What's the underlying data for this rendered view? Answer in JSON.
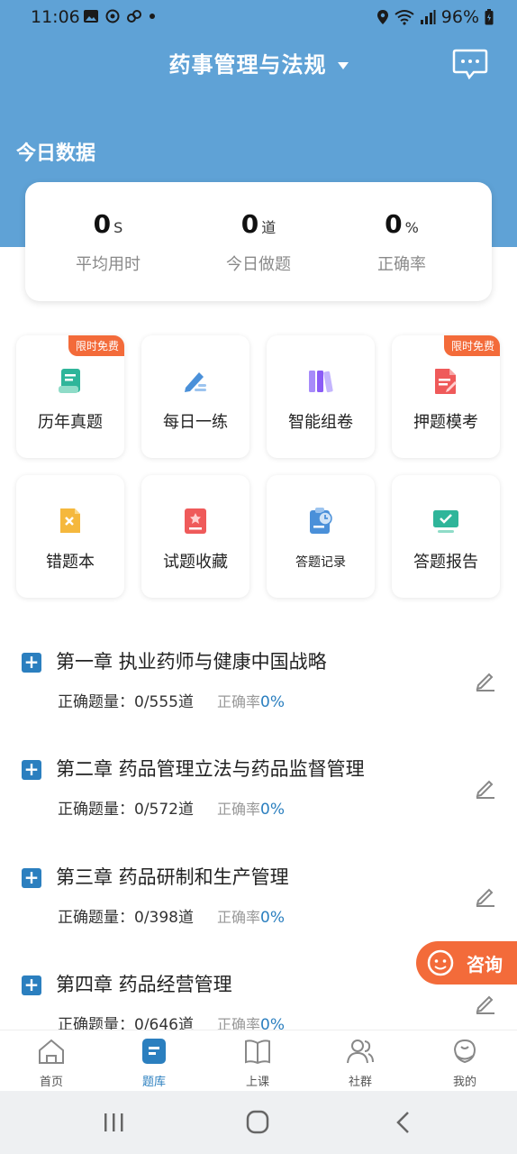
{
  "status_bar": {
    "time": "11:06",
    "battery": "96%"
  },
  "header": {
    "title": "药事管理与法规"
  },
  "today": {
    "section_title": "今日数据",
    "stats": [
      {
        "value": "0",
        "unit": "S",
        "label": "平均用时"
      },
      {
        "value": "0",
        "unit": "道",
        "label": "今日做题"
      },
      {
        "value": "0",
        "unit": "%",
        "label": "正确率"
      }
    ]
  },
  "tiles": [
    {
      "label": "历年真题",
      "badge": "限时免费",
      "icon": "book-icon",
      "color": "#2fb59a"
    },
    {
      "label": "每日一练",
      "badge": "",
      "icon": "pencil-icon",
      "color": "#4a90d9"
    },
    {
      "label": "智能组卷",
      "badge": "",
      "icon": "books-icon",
      "color": "#8b5cf6"
    },
    {
      "label": "押题模考",
      "badge": "限时免费",
      "icon": "document-icon",
      "color": "#ef5a5a"
    },
    {
      "label": "错题本",
      "badge": "",
      "icon": "wrong-note-icon",
      "color": "#f5b83d"
    },
    {
      "label": "试题收藏",
      "badge": "",
      "icon": "favorite-icon",
      "color": "#ef5a5a"
    },
    {
      "label": "答题记录",
      "badge": "",
      "icon": "clipboard-clock-icon",
      "color": "#4a90d9"
    },
    {
      "label": "答题报告",
      "badge": "",
      "icon": "monitor-check-icon",
      "color": "#2fb59a"
    }
  ],
  "chapters": [
    {
      "title": "第一章 执业药师与健康中国战略",
      "correct_label": "正确题量：",
      "correct_value": "0/555道",
      "rate_label": "正确率",
      "rate_value": "0%"
    },
    {
      "title": "第二章 药品管理立法与药品监督管理",
      "correct_label": "正确题量：",
      "correct_value": "0/572道",
      "rate_label": "正确率",
      "rate_value": "0%"
    },
    {
      "title": "第三章 药品研制和生产管理",
      "correct_label": "正确题量：",
      "correct_value": "0/398道",
      "rate_label": "正确率",
      "rate_value": "0%"
    },
    {
      "title": "第四章 药品经营管理",
      "correct_label": "正确题量：",
      "correct_value": "0/646道",
      "rate_label": "正确率",
      "rate_value": "0%"
    }
  ],
  "consult": {
    "label": "咨询"
  },
  "tabbar": [
    {
      "label": "首页",
      "icon": "home-icon",
      "active": false
    },
    {
      "label": "题库",
      "icon": "question-bank-icon",
      "active": true
    },
    {
      "label": "上课",
      "icon": "open-book-icon",
      "active": false
    },
    {
      "label": "社群",
      "icon": "community-icon",
      "active": false
    },
    {
      "label": "我的",
      "icon": "profile-icon",
      "active": false
    }
  ],
  "colors": {
    "header": "#5fa2d6",
    "accent": "#2b7fbf",
    "badge": "#f36b3a"
  }
}
